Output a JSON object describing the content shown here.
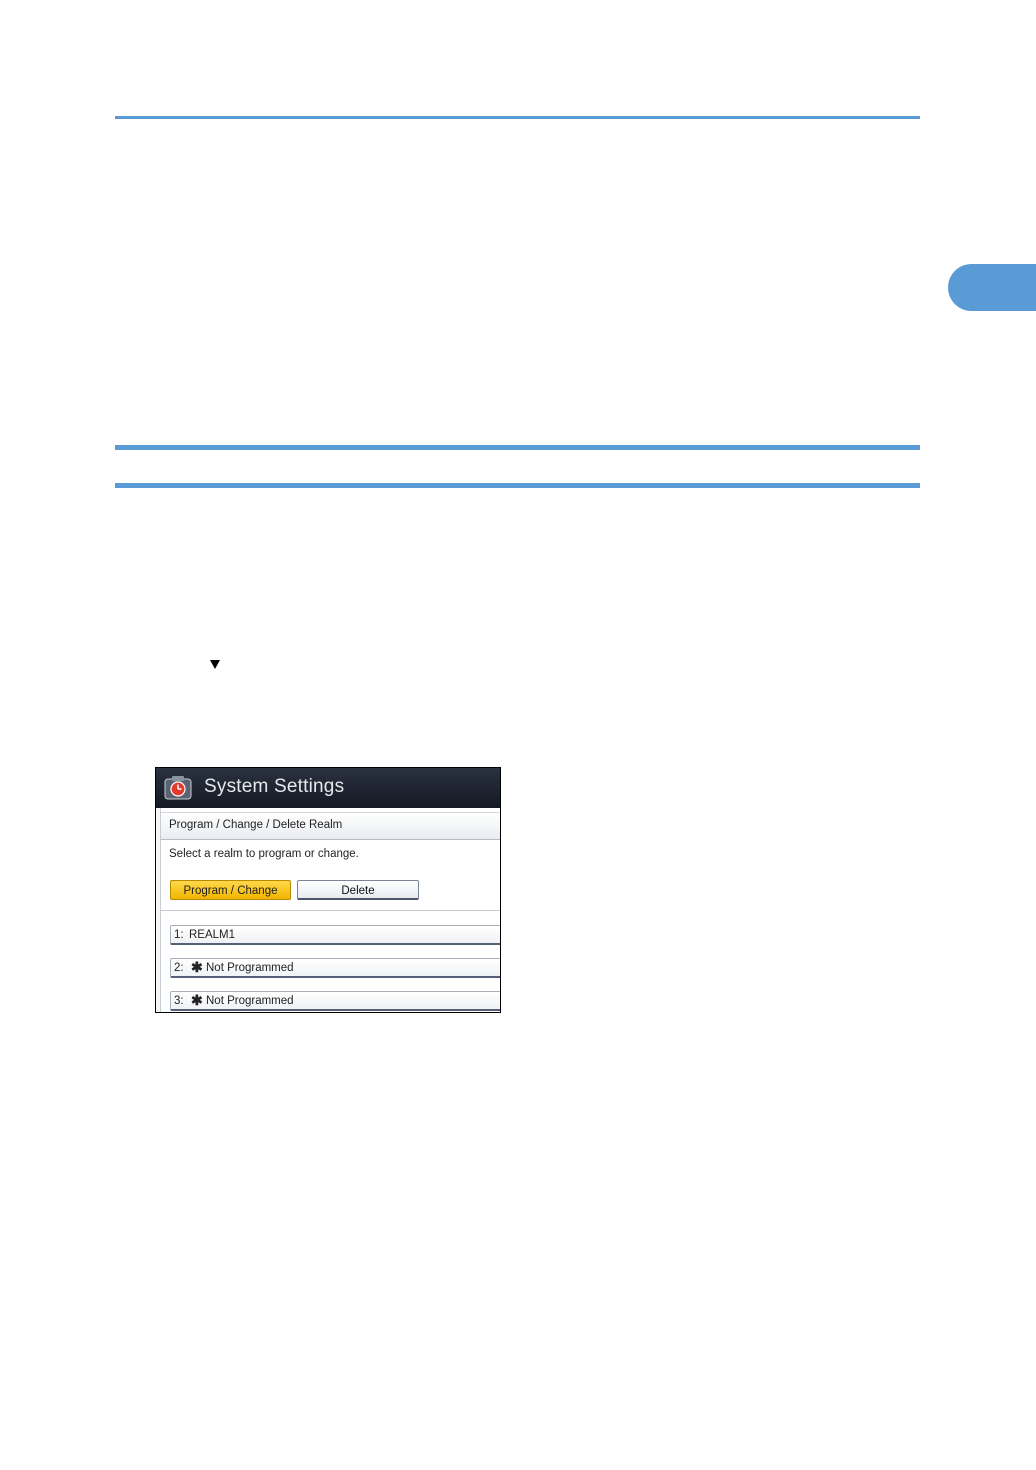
{
  "screenshot": {
    "app_title": "System Settings",
    "breadcrumb": "Program / Change / Delete Realm",
    "instruction": "Select a realm to program or change.",
    "buttons": {
      "program_change": "Program / Change",
      "delete": "Delete"
    },
    "realms": [
      {
        "number": "1:",
        "mark": "",
        "name": "REALM1"
      },
      {
        "number": "2:",
        "mark": "✱",
        "name": "Not Programmed"
      },
      {
        "number": "3:",
        "mark": "✱",
        "name": "Not Programmed"
      }
    ]
  },
  "colors": {
    "accent": "#5b9bd5",
    "selected_button": "#f3b600"
  },
  "icons": {
    "step_marker": "down-arrow-icon",
    "app": "system-settings-icon"
  }
}
